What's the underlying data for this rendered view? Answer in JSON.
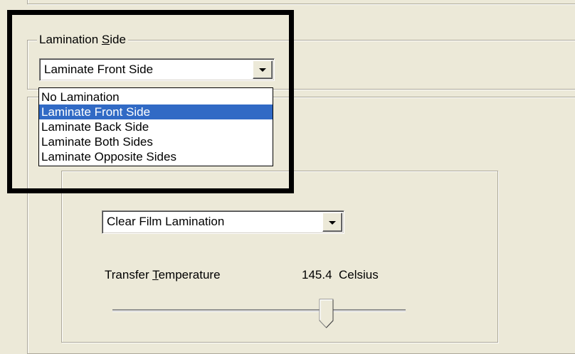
{
  "lamination_side": {
    "group_label": "Lamination Side",
    "group_label_prefix": "Lamination ",
    "group_label_mnemonic": "S",
    "group_label_suffix": "ide",
    "selected": "Laminate Front Side",
    "options": [
      {
        "label": "No Lamination",
        "selected": false
      },
      {
        "label": "Laminate Front Side",
        "selected": true
      },
      {
        "label": "Laminate Back Side",
        "selected": false
      },
      {
        "label": "Laminate Both Sides",
        "selected": false
      },
      {
        "label": "Laminate Opposite Sides",
        "selected": false
      }
    ]
  },
  "film": {
    "selected": "Clear Film Lamination"
  },
  "transfer_temperature": {
    "label_prefix": "Transfer ",
    "label_mnemonic": "T",
    "label_suffix": "emperature",
    "value": "145.4",
    "unit": "Celsius",
    "slider_position": 0.73
  },
  "colors": {
    "dialog_bg": "#ece9d8",
    "selection_bg": "#316ac5",
    "highlight_border": "#000000"
  }
}
